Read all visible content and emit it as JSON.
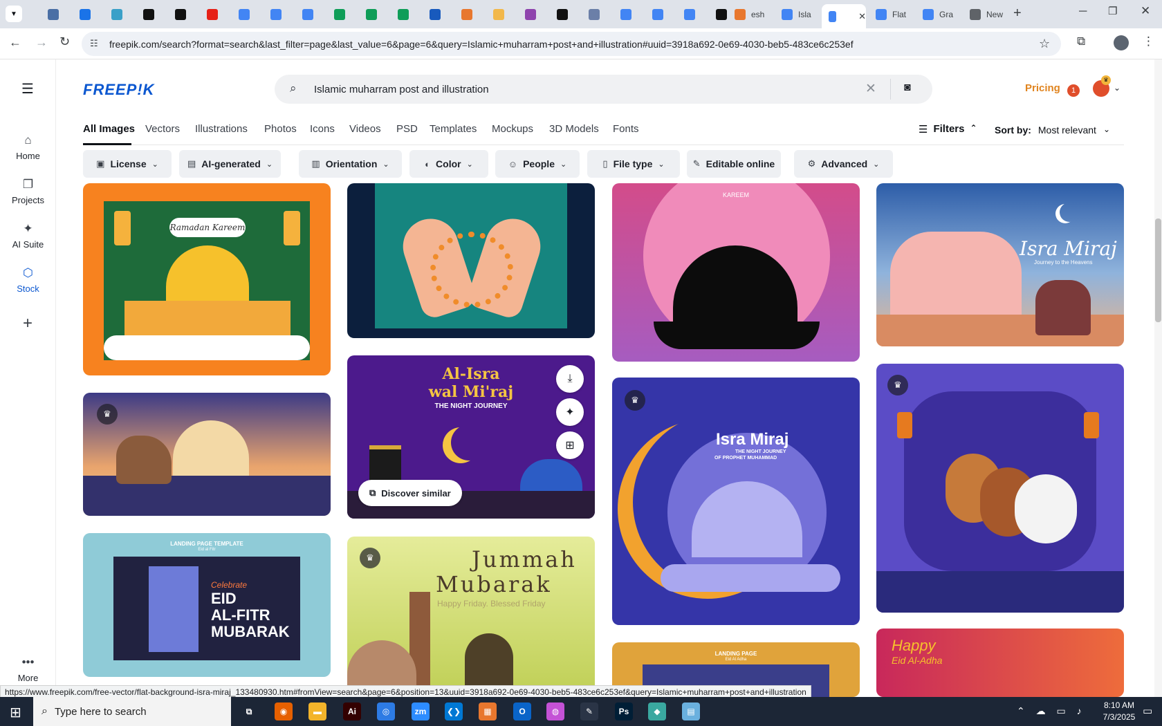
{
  "browser": {
    "tabs": [
      {
        "icon": "app-icon",
        "color": "#4a6fa5"
      },
      {
        "icon": "shield-icon",
        "color": "#1a73e8"
      },
      {
        "icon": "chat-icon",
        "color": "#3aa0c8"
      },
      {
        "icon": "threads-icon",
        "color": "#111111"
      },
      {
        "icon": "bolt-icon",
        "color": "#111111"
      },
      {
        "icon": "youtube-icon",
        "color": "#e62117"
      },
      {
        "icon": "docs-icon",
        "color": "#4285f4"
      },
      {
        "icon": "docs-icon",
        "color": "#4285f4"
      },
      {
        "icon": "docs-icon",
        "color": "#4285f4"
      },
      {
        "icon": "sheets-icon",
        "color": "#0f9d58"
      },
      {
        "icon": "sheets-icon",
        "color": "#0f9d58"
      },
      {
        "icon": "sheets-icon",
        "color": "#0f9d58"
      },
      {
        "icon": "word-icon",
        "color": "#185abd"
      },
      {
        "icon": "grid-icon",
        "color": "#e8772e"
      },
      {
        "icon": "bird-icon",
        "color": "#f2b84b"
      },
      {
        "icon": "code-icon",
        "color": "#8e44ad"
      },
      {
        "icon": "ai-icon",
        "color": "#111111"
      },
      {
        "icon": "table-icon",
        "color": "#6b7fa8"
      },
      {
        "icon": "docs-icon",
        "color": "#4285f4"
      },
      {
        "icon": "docs-icon",
        "color": "#4285f4"
      },
      {
        "icon": "docs-icon",
        "color": "#4285f4"
      },
      {
        "icon": "medium-icon",
        "color": "#111111"
      }
    ],
    "named_tabs": [
      {
        "label": "esh",
        "icon": "grid-icon",
        "color": "#e8772e"
      },
      {
        "label": "Isla",
        "icon": "docs-icon",
        "color": "#4285f4"
      },
      {
        "label": "",
        "icon": "docs-icon",
        "color": "#4285f4",
        "active": true
      },
      {
        "label": "Flat",
        "icon": "docs-icon",
        "color": "#4285f4"
      },
      {
        "label": "Gra",
        "icon": "docs-icon",
        "color": "#4285f4"
      },
      {
        "label": "New",
        "icon": "chrome-icon",
        "color": "#5f6368"
      }
    ],
    "url": "freepik.com/search?format=search&last_filter=page&last_value=6&page=6&query=Islamic+muharram+post+and+illustration#uuid=3918a692-0e69-4030-beb5-483ce6c253ef",
    "status_url": "https://www.freepik.com/free-vector/flat-background-isra-miraj_133480930.htm#fromView=search&page=6&position=13&uuid=3918a692-0e69-4030-beb5-483ce6c253ef&query=Islamic+muharram+post+and+illustration"
  },
  "sidebar": {
    "items": [
      {
        "label": "Home",
        "icon": "home-icon"
      },
      {
        "label": "Projects",
        "icon": "projects-icon"
      },
      {
        "label": "AI Suite",
        "icon": "sparkle-icon"
      },
      {
        "label": "Stock",
        "icon": "stock-icon"
      }
    ],
    "more_label": "More"
  },
  "header": {
    "logo": "FREEP!K",
    "search_value": "Islamic muharram post and illustration",
    "pricing": "Pricing",
    "notification_count": "1"
  },
  "nav": {
    "tabs": [
      "All Images",
      "Vectors",
      "Illustrations",
      "Photos",
      "Icons",
      "Videos",
      "PSD",
      "Templates",
      "Mockups",
      "3D Models",
      "Fonts"
    ],
    "filters_label": "Filters",
    "sort_label": "Sort by:",
    "sort_value": "Most relevant"
  },
  "chips": [
    {
      "label": "License",
      "icon": "license-icon"
    },
    {
      "label": "AI-generated",
      "icon": "ai-generated-icon"
    },
    {
      "label": "Orientation",
      "icon": "orientation-icon"
    },
    {
      "label": "Color",
      "icon": "palette-icon"
    },
    {
      "label": "People",
      "icon": "people-icon"
    },
    {
      "label": "File type",
      "icon": "file-icon"
    },
    {
      "label": "Editable online",
      "icon": "pencil-icon"
    },
    {
      "label": "Advanced",
      "icon": "gear-icon"
    }
  ],
  "cards": {
    "ramadan": "Ramadan Kareem",
    "kareem": "KAREEM",
    "isra_miraj_1": "Isra Miraj",
    "isra_miraj_1_sub": "Journey to the Heavens",
    "alisra_title1": "Al-Isra",
    "alisra_title2": "wal Mi'raj",
    "alisra_sub": "THE NIGHT JOURNEY",
    "discover_similar": "Discover similar",
    "isra_miraj_2": "Isra Miraj",
    "isra_miraj_2_sub1": "THE NIGHT JOURNEY",
    "isra_miraj_2_sub2": "OF PROPHET MUHAMMAD",
    "landing_title": "LANDING PAGE TEMPLATE",
    "landing_sub": "Eid al Fitr",
    "eid_celebrate": "Celebrate",
    "eid_line1": "EID",
    "eid_line2": "AL-FITR",
    "eid_line3": "MUBARAK",
    "jummah1": "Jummah",
    "jummah2": "Mubarak",
    "jummah_sub": "Happy Friday. Blessed Friday",
    "landing2_title": "LANDING PAGE",
    "landing2_sub": "Eid Al Adha",
    "happy": "Happy",
    "eid_adha": "Eid Al-Adha"
  },
  "taskbar": {
    "search_placeholder": "Type here to search",
    "time": "8:10 AM",
    "date": "7/3/2025",
    "apps": [
      {
        "icon": "taskview-icon",
        "color": "#1c2636"
      },
      {
        "icon": "firefox-icon",
        "color": "#e66000"
      },
      {
        "icon": "explorer-icon",
        "color": "#f3b42b"
      },
      {
        "icon": "illustrator-icon",
        "color": "#330000"
      },
      {
        "icon": "chrome-icon",
        "color": "#2d7be4"
      },
      {
        "icon": "zoom-icon",
        "color": "#2d8cff"
      },
      {
        "icon": "vscode-icon",
        "color": "#0078d4"
      },
      {
        "icon": "grid-icon",
        "color": "#e8772e"
      },
      {
        "icon": "outlook-icon",
        "color": "#0a64c8"
      },
      {
        "icon": "paint-icon",
        "color": "#c452d6"
      },
      {
        "icon": "pen-icon",
        "color": "#2a3446"
      },
      {
        "icon": "photoshop-icon",
        "color": "#001e36"
      },
      {
        "icon": "gem-icon",
        "color": "#3aa8a0"
      },
      {
        "icon": "notepad-icon",
        "color": "#6ab0de"
      }
    ]
  }
}
